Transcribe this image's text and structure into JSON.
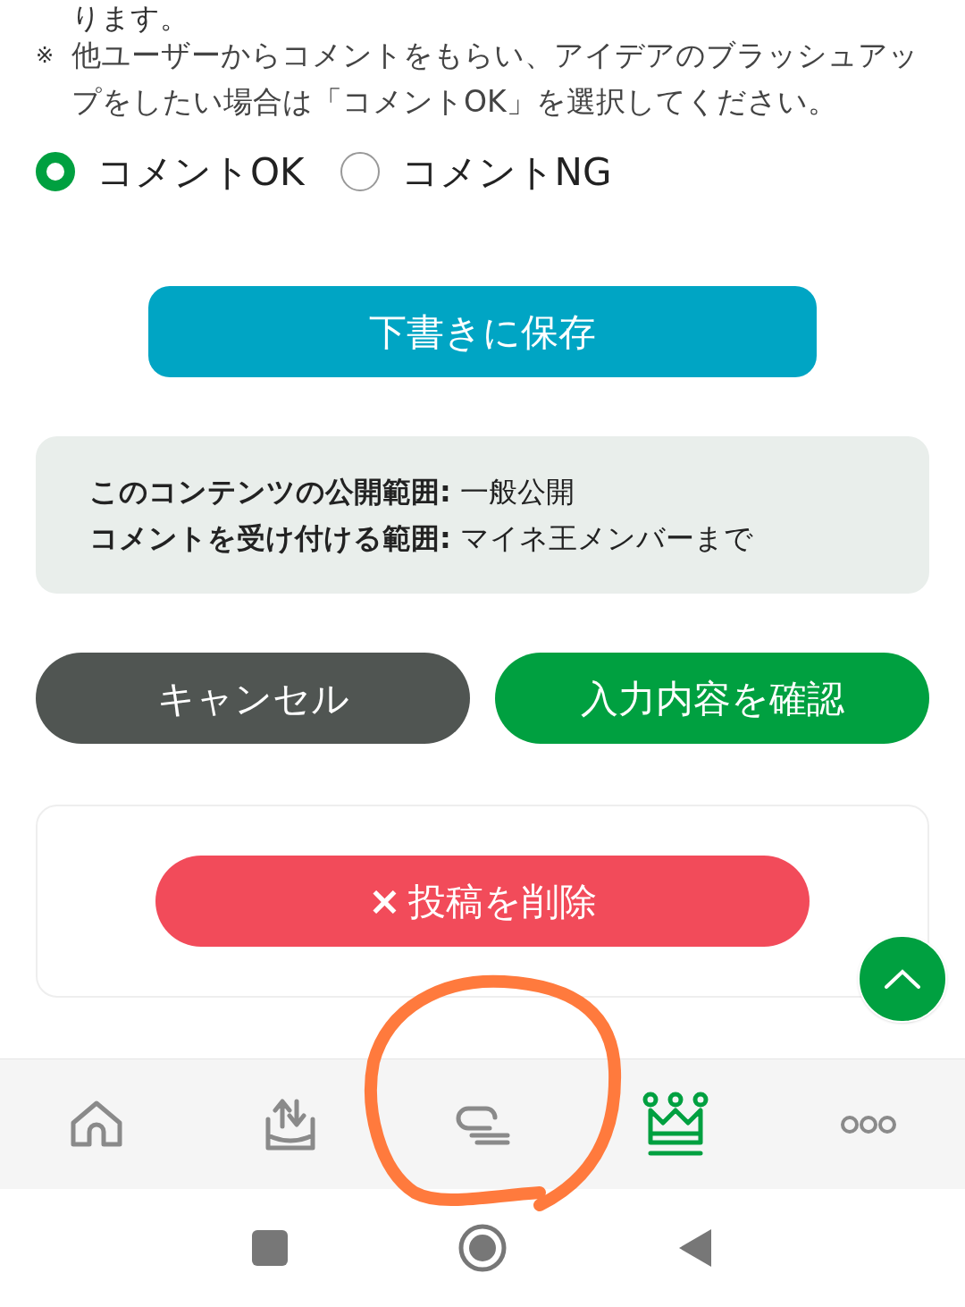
{
  "top_text": "ります。",
  "note": {
    "mark": "※",
    "text": "他ユーザーからコメントをもらい、アイデアのブラッシュアップをしたい場合は「コメントOK」を選択してください。"
  },
  "comment_options": [
    {
      "label": "コメントOK",
      "selected": true
    },
    {
      "label": "コメントNG",
      "selected": false
    }
  ],
  "save_button": "下書きに保存",
  "info": [
    {
      "label": "このコンテンツの公開範囲:",
      "value": "一般公開"
    },
    {
      "label": "コメントを受け付ける範囲:",
      "value": "マイネ王メンバーまで"
    }
  ],
  "cancel_button": "キャンセル",
  "confirm_button": "入力内容を確認",
  "delete_button": {
    "icon": "×",
    "label": "投稿を削除"
  },
  "bottom_nav": [
    {
      "kind": "home",
      "selected": false
    },
    {
      "kind": "upload",
      "selected": false
    },
    {
      "kind": "comment",
      "selected": false
    },
    {
      "kind": "crown",
      "selected": true
    },
    {
      "kind": "more",
      "selected": false
    }
  ]
}
